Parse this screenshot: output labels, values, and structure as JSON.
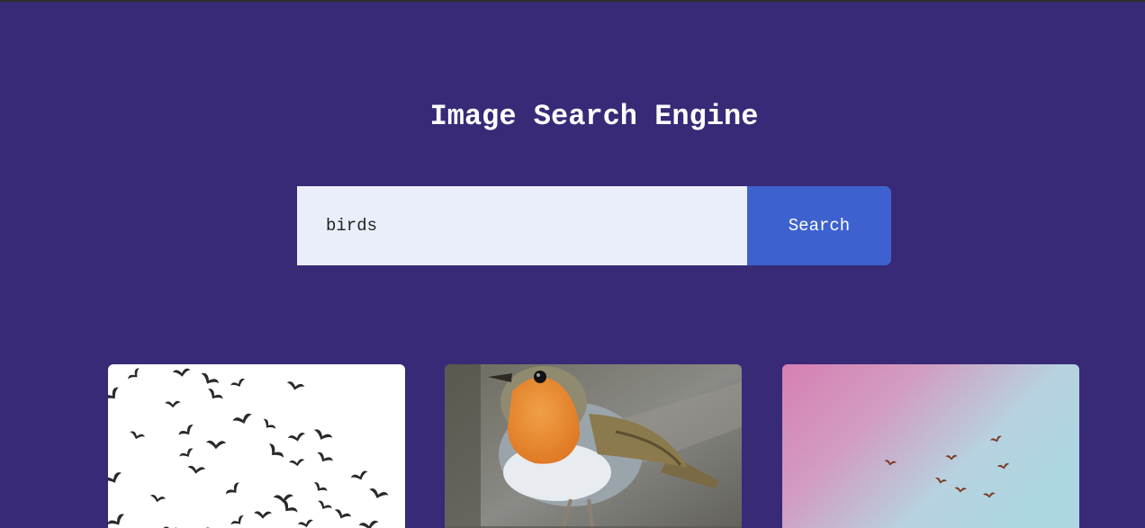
{
  "app": {
    "title": "Image Search Engine"
  },
  "search": {
    "value": "birds",
    "button_label": "Search"
  },
  "results": [
    {
      "subject": "flock of birds on white sky"
    },
    {
      "subject": "european robin perched"
    },
    {
      "subject": "birds flying on pink and blue sky"
    }
  ],
  "colors": {
    "background": "#382a77",
    "input_bg": "#eaeefa",
    "button_bg": "#3d62cf",
    "text_light": "#ffffff"
  }
}
